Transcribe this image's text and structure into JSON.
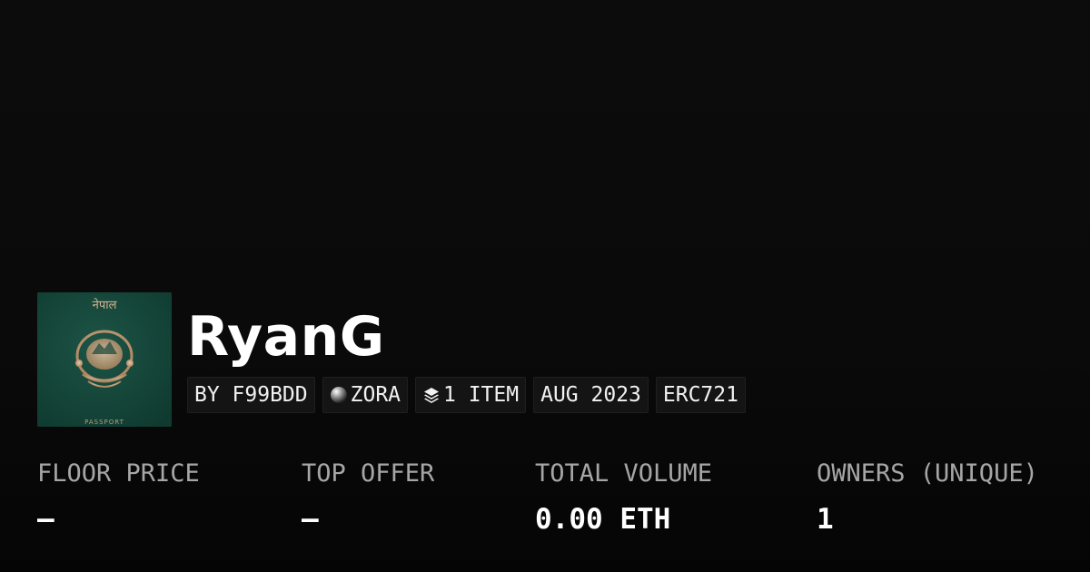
{
  "collection": {
    "name": "RyanG",
    "image": {
      "icon": "passport-cover-image",
      "top_text": "नेपाल",
      "bottom_text": "PASSPORT",
      "cover_color": "#17443a",
      "emblem_color": "#c8a27c"
    }
  },
  "chips": [
    {
      "label": "BY F99BDD"
    },
    {
      "icon": "zora-orb-icon",
      "label": "ZORA"
    },
    {
      "icon": "layers-icon",
      "label": "1 ITEM"
    },
    {
      "label": "AUG 2023"
    },
    {
      "label": "ERC721"
    }
  ],
  "stats": [
    {
      "label": "FLOOR PRICE",
      "value": "–"
    },
    {
      "label": "TOP OFFER",
      "value": "–"
    },
    {
      "label": "TOTAL VOLUME",
      "value": "0.00 ETH"
    },
    {
      "label": "OWNERS (UNIQUE)",
      "value": "1"
    }
  ],
  "colors": {
    "background": "#0a0a0a",
    "chip_background": "#141414",
    "label_gray": "#a6a6a6",
    "text": "#ffffff"
  }
}
